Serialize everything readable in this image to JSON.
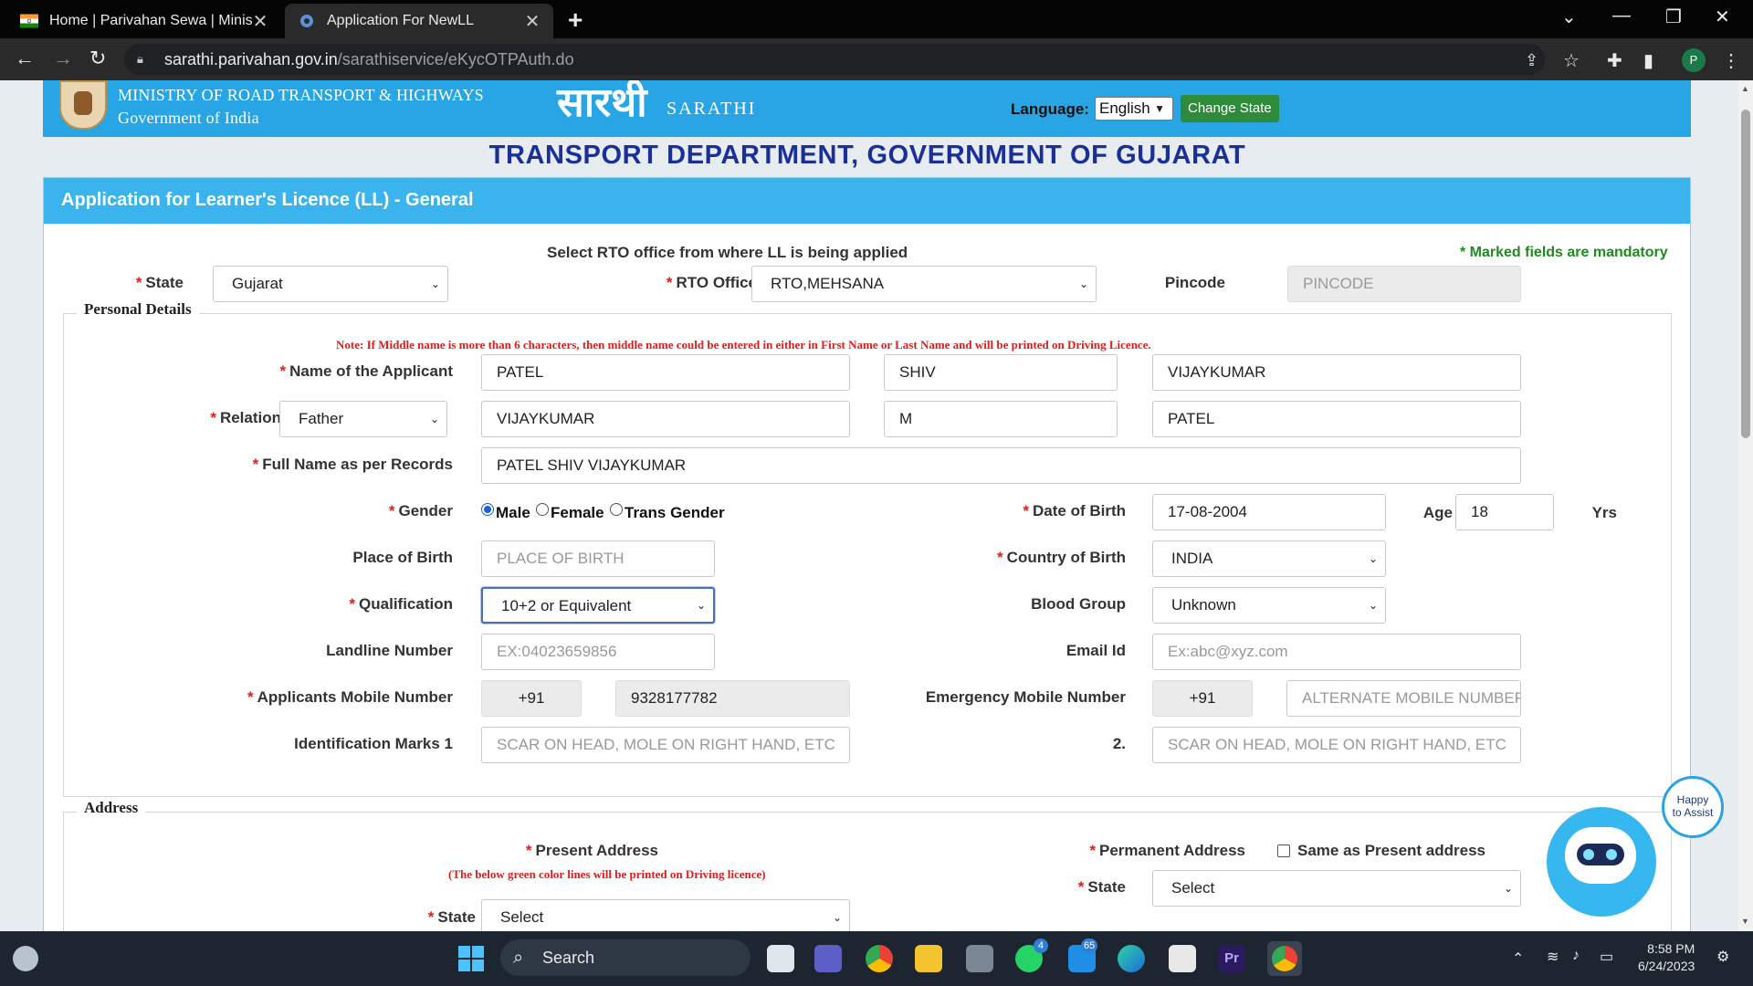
{
  "browser": {
    "tabs": [
      {
        "title": "Home | Parivahan Sewa | Ministry of Road Transport",
        "active": false
      },
      {
        "title": "Application For NewLL",
        "active": true
      }
    ],
    "url_host": "sarathi.parivahan.gov.in",
    "url_path": "/sarathiservice/eKycOTPAuth.do",
    "profile_initial": "P"
  },
  "header": {
    "ministry_line1": "MINISTRY OF ROAD TRANSPORT & HIGHWAYS",
    "ministry_line2": "Government of India",
    "logo_text": "सारथी",
    "sarathi": "SARATHI",
    "language_label": "Language:",
    "language_value": "English",
    "change_state": "Change State"
  },
  "dept_title": "TRANSPORT DEPARTMENT, GOVERNMENT OF GUJARAT",
  "form": {
    "card_title": "Application for Learner's Licence (LL) - General",
    "rto_heading": "Select RTO office from where LL is being applied",
    "mandatory_note": "* Marked fields are mandatory",
    "state_label": "State",
    "state_value": "Gujarat",
    "rto_label": "RTO Office",
    "rto_value": "RTO,MEHSANA",
    "pincode_label": "Pincode",
    "pincode_placeholder": "PINCODE",
    "personal_legend": "Personal Details",
    "middle_name_note": "Note: If Middle name is more than 6 characters, then middle name could be entered in either in First Name or Last Name and will be printed on Driving Licence.",
    "name_label": "Name of the Applicant",
    "name_first": "PATEL",
    "name_middle": "SHIV",
    "name_last": "VIJAYKUMAR",
    "relation_label": "Relation",
    "relation_value": "Father",
    "rel_first": "VIJAYKUMAR",
    "rel_middle": "M",
    "rel_last": "PATEL",
    "fullname_label": "Full Name as per Records",
    "fullname_value": "PATEL SHIV VIJAYKUMAR",
    "gender_label": "Gender",
    "gender_options": [
      "Male",
      "Female",
      "Trans Gender"
    ],
    "gender_selected": "Male",
    "dob_label": "Date of Birth",
    "dob_value": "17-08-2004",
    "age_label": "Age",
    "age_value": "18",
    "yrs_label": "Yrs",
    "pob_label": "Place of Birth",
    "pob_placeholder": "PLACE OF BIRTH",
    "country_label": "Country of Birth",
    "country_value": "INDIA",
    "qual_label": "Qualification",
    "qual_value": "10+2 or Equivalent",
    "blood_label": "Blood Group",
    "blood_value": "Unknown",
    "landline_label": "Landline Number",
    "landline_placeholder": "EX:04023659856",
    "email_label": "Email Id",
    "email_placeholder": "Ex:abc@xyz.com",
    "mobile_label": "Applicants Mobile Number",
    "mobile_code": "+91",
    "mobile_value": "9328177782",
    "emerg_label": "Emergency Mobile Number",
    "emerg_code": "+91",
    "emerg_placeholder": "ALTERNATE MOBILE NUMBER",
    "idmark1_label": "Identification Marks 1",
    "idmark1_placeholder": "SCAR ON HEAD, MOLE ON RIGHT HAND, ETC",
    "idmark2_label": "2.",
    "idmark2_placeholder": "SCAR ON HEAD, MOLE ON RIGHT HAND, ETC",
    "address_legend": "Address",
    "present_label": "Present Address",
    "present_note": "(The below green color lines will be printed on Driving licence)",
    "permanent_label": "Permanent Address",
    "same_as_label": "Same as Present address",
    "perm_state_label": "State",
    "perm_state_value": "Select",
    "present_state_label": "State",
    "present_state_value": "Select"
  },
  "assistant": {
    "bubble_line1": "Happy",
    "bubble_line2": "to Assist"
  },
  "taskbar": {
    "search": "Search",
    "badges": {
      "whatsapp": "4",
      "mail": "65"
    },
    "time": "8:58 PM",
    "date": "6/24/2023"
  }
}
